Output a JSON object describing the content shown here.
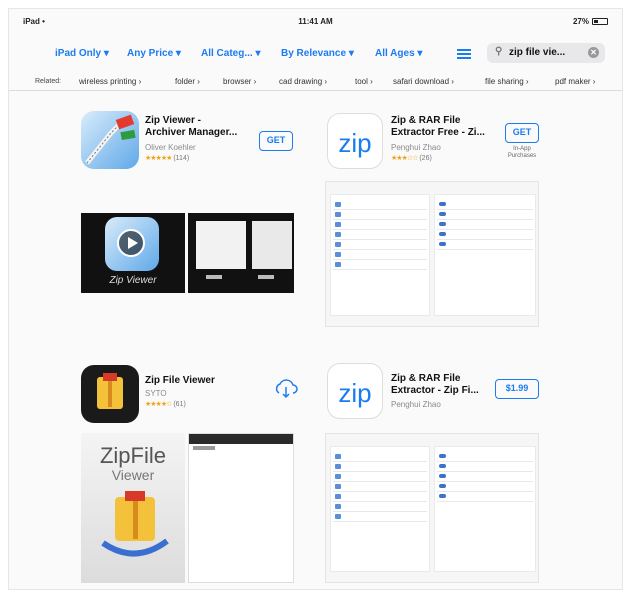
{
  "status_bar": {
    "device": "iPad",
    "time": "11:41 AM",
    "battery": "27%"
  },
  "filters": {
    "ipad_only": "iPad Only ▾",
    "any_price": "Any Price ▾",
    "all_categories": "All Categ... ▾",
    "by_relevance": "By Relevance ▾",
    "all_ages": "All Ages ▾"
  },
  "search": {
    "query": "zip file vie..."
  },
  "related": {
    "label": "Related:",
    "items": [
      "wireless printing ›",
      "folder ›",
      "browser ›",
      "cad drawing ›",
      "tool ›",
      "safari download ›",
      "file sharing ›",
      "pdf maker ›"
    ]
  },
  "apps": [
    {
      "title_line1": "Zip Viewer -",
      "title_line2": "Archiver Manager...",
      "developer": "Oliver Koehler",
      "stars": "★★★★★",
      "rating_count": "(114)",
      "action": "GET",
      "screenshot_caption": "Zip Viewer"
    },
    {
      "title_line1": "Zip & RAR File",
      "title_line2": "Extractor Free - Zi...",
      "developer": "Penghui Zhao",
      "stars": "★★★☆☆",
      "rating_count": "(26)",
      "action": "GET",
      "action_note": "In-App Purchases",
      "icon_text": "zip"
    },
    {
      "title_line1": "Zip File Viewer",
      "developer": "SYTO",
      "stars": "★★★★☆",
      "rating_count": "(61)",
      "action": "download",
      "screenshot_brand_1": "ZipFile",
      "screenshot_brand_2": "Viewer"
    },
    {
      "title_line1": "Zip & RAR File",
      "title_line2": "Extractor - Zip Fi...",
      "developer": "Penghui Zhao",
      "action": "$1.99",
      "icon_text": "zip"
    }
  ],
  "colors": {
    "accent": "#1a7cf0",
    "star": "#f0a21a"
  },
  "icons": [
    "wifi-icon",
    "battery-icon",
    "list-icon",
    "search-icon",
    "clear-icon",
    "cloud-download-icon",
    "play-icon"
  ]
}
